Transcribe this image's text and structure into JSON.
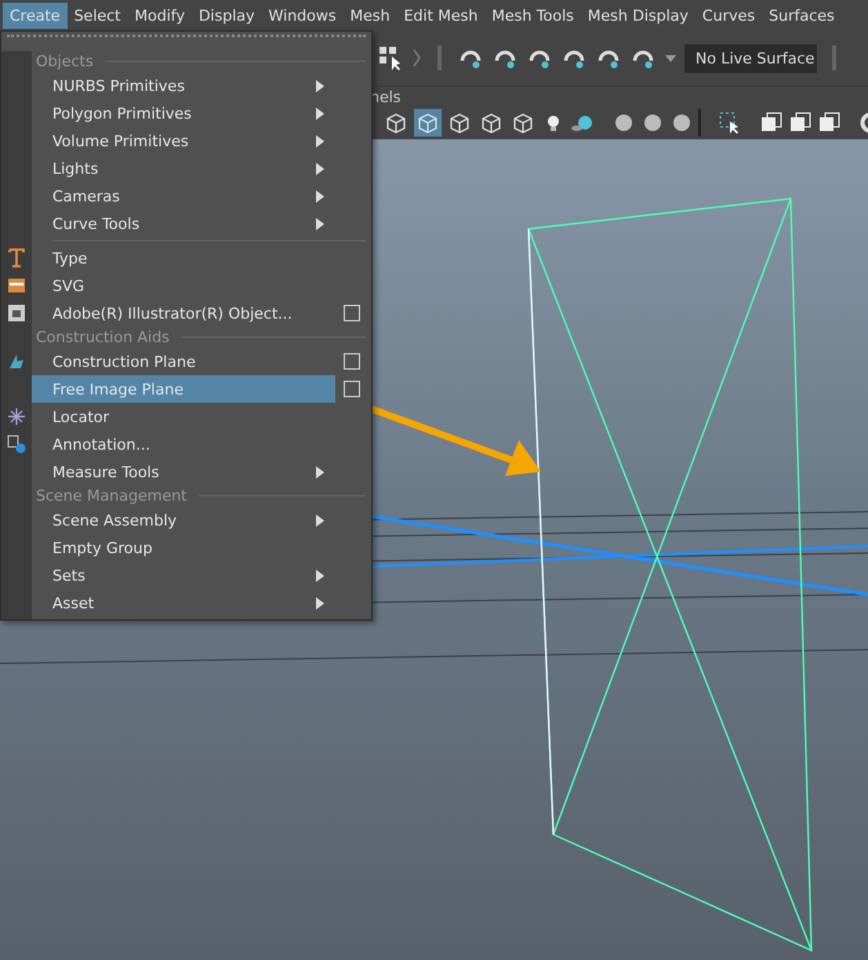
{
  "menubar": [
    {
      "label": "Create",
      "selected": true
    },
    {
      "label": "Select",
      "selected": false
    },
    {
      "label": "Modify",
      "selected": false
    },
    {
      "label": "Display",
      "selected": false
    },
    {
      "label": "Windows",
      "selected": false
    },
    {
      "label": "Mesh",
      "selected": false
    },
    {
      "label": "Edit Mesh",
      "selected": false
    },
    {
      "label": "Mesh Tools",
      "selected": false
    },
    {
      "label": "Mesh Display",
      "selected": false
    },
    {
      "label": "Curves",
      "selected": false
    },
    {
      "label": "Surfaces",
      "selected": false
    }
  ],
  "status_line": {
    "live_surface": "No Live Surface"
  },
  "panel_menu": {
    "label": "nels"
  },
  "shading_buttons": [
    {
      "selected": false
    },
    {
      "selected": true
    },
    {
      "selected": false
    },
    {
      "selected": false
    },
    {
      "selected": false
    }
  ],
  "create_menu": [
    {
      "kind": "header",
      "label": "Objects"
    },
    {
      "kind": "item",
      "label": "NURBS Primitives",
      "submenu": true,
      "option_box": false,
      "selected": false
    },
    {
      "kind": "item",
      "label": "Polygon Primitives",
      "submenu": true,
      "option_box": false,
      "selected": false
    },
    {
      "kind": "item",
      "label": "Volume Primitives",
      "submenu": true,
      "option_box": false,
      "selected": false
    },
    {
      "kind": "item",
      "label": "Lights",
      "submenu": true,
      "option_box": false,
      "selected": false
    },
    {
      "kind": "item",
      "label": "Cameras",
      "submenu": true,
      "option_box": false,
      "selected": false
    },
    {
      "kind": "item",
      "label": "Curve Tools",
      "submenu": true,
      "option_box": false,
      "selected": false
    },
    {
      "kind": "separator"
    },
    {
      "kind": "item",
      "label": "Type",
      "submenu": false,
      "option_box": false,
      "selected": false
    },
    {
      "kind": "item",
      "label": "SVG",
      "submenu": false,
      "option_box": false,
      "selected": false
    },
    {
      "kind": "item",
      "label": "Adobe(R) Illustrator(R) Object...",
      "submenu": false,
      "option_box": true,
      "selected": false
    },
    {
      "kind": "header",
      "label": "Construction Aids"
    },
    {
      "kind": "item",
      "label": "Construction Plane",
      "submenu": false,
      "option_box": true,
      "selected": false
    },
    {
      "kind": "item",
      "label": "Free Image Plane",
      "submenu": false,
      "option_box": true,
      "selected": true
    },
    {
      "kind": "item",
      "label": "Locator",
      "submenu": false,
      "option_box": false,
      "selected": false
    },
    {
      "kind": "item",
      "label": "Annotation...",
      "submenu": false,
      "option_box": false,
      "selected": false
    },
    {
      "kind": "item",
      "label": "Measure Tools",
      "submenu": true,
      "option_box": false,
      "selected": false
    },
    {
      "kind": "header",
      "label": "Scene Management"
    },
    {
      "kind": "item",
      "label": "Scene Assembly",
      "submenu": true,
      "option_box": false,
      "selected": false
    },
    {
      "kind": "item",
      "label": "Empty Group",
      "submenu": false,
      "option_box": false,
      "selected": false
    },
    {
      "kind": "item",
      "label": "Sets",
      "submenu": true,
      "option_box": false,
      "selected": false
    },
    {
      "kind": "item",
      "label": "Asset",
      "submenu": true,
      "option_box": false,
      "selected": false
    }
  ]
}
